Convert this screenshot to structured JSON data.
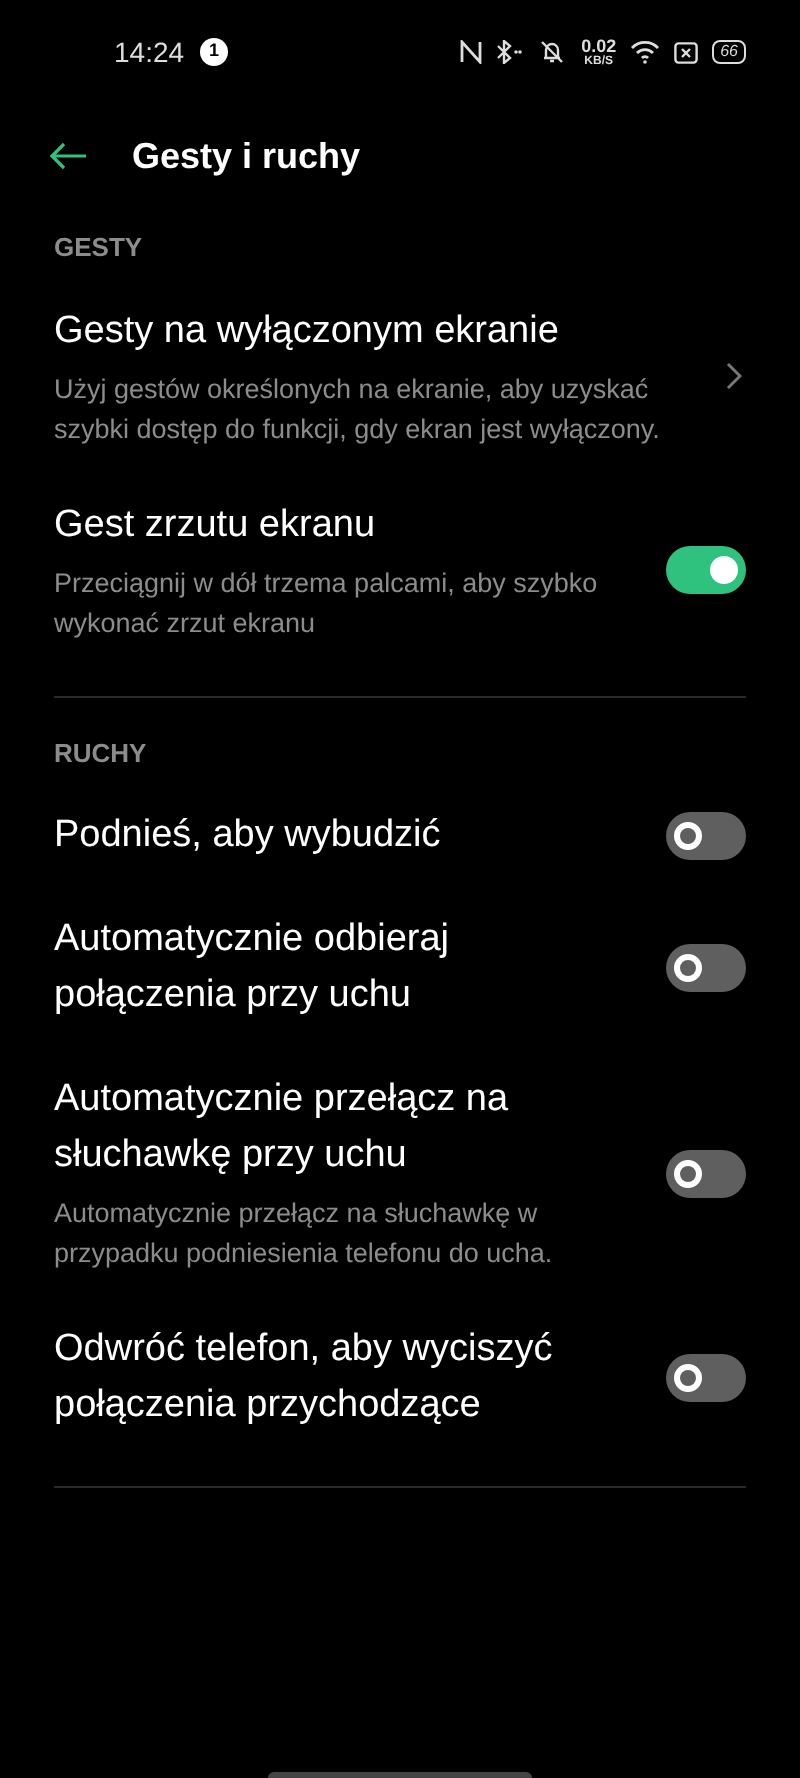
{
  "status_bar": {
    "time": "14:24",
    "notification_count": "1",
    "speed_value": "0.02",
    "speed_unit": "KB/S",
    "battery": "66"
  },
  "header": {
    "title": "Gesty i ruchy"
  },
  "sections": [
    {
      "heading": "GESTY",
      "items": [
        {
          "kind": "link",
          "title": "Gesty na wyłączonym ekranie",
          "subtitle": "Użyj gestów określonych na ekranie, aby uzyskać szybki dostęp do funkcji, gdy ekran jest wyłączony."
        },
        {
          "kind": "toggle",
          "title": "Gest zrzutu ekranu",
          "subtitle": "Przeciągnij w dół trzema palcami, aby szybko wykonać zrzut ekranu",
          "on": true
        }
      ]
    },
    {
      "heading": "RUCHY",
      "items": [
        {
          "kind": "toggle",
          "title": "Podnieś, aby wybudzić",
          "on": false
        },
        {
          "kind": "toggle",
          "title": "Automatycznie odbieraj połączenia przy uchu",
          "on": false
        },
        {
          "kind": "toggle",
          "title": "Automatycznie przełącz na słuchawkę przy uchu",
          "subtitle": "Automatycznie przełącz na słuchawkę w przypadku podniesienia telefonu do ucha.",
          "on": false
        },
        {
          "kind": "toggle",
          "title": "Odwróć telefon, aby wyciszyć połączenia przychodzące",
          "on": false
        }
      ]
    }
  ]
}
